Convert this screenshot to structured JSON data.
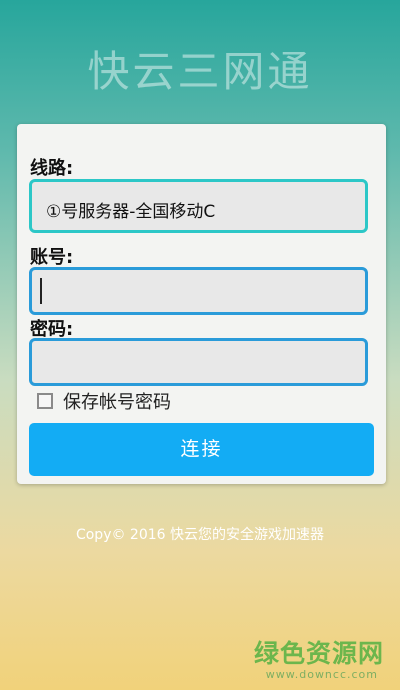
{
  "app": {
    "title": "快云三网通"
  },
  "form": {
    "line_label": "线路:",
    "line_value": "①号服务器-全国移动C",
    "account_label": "账号:",
    "account_value": "",
    "password_label": "密码:",
    "password_value": "",
    "remember_label": "保存帐号密码",
    "remember_checked": false,
    "connect_label": "连接"
  },
  "footer": {
    "copyright": "Copy© 2016 快云您的安全游戏加速器"
  },
  "watermark": {
    "logo": "绿色资源网",
    "url": "www.downcc.com"
  },
  "colors": {
    "accent": "#13acf4",
    "select_border": "#2cc7c7",
    "input_border": "#2a9bd9"
  }
}
